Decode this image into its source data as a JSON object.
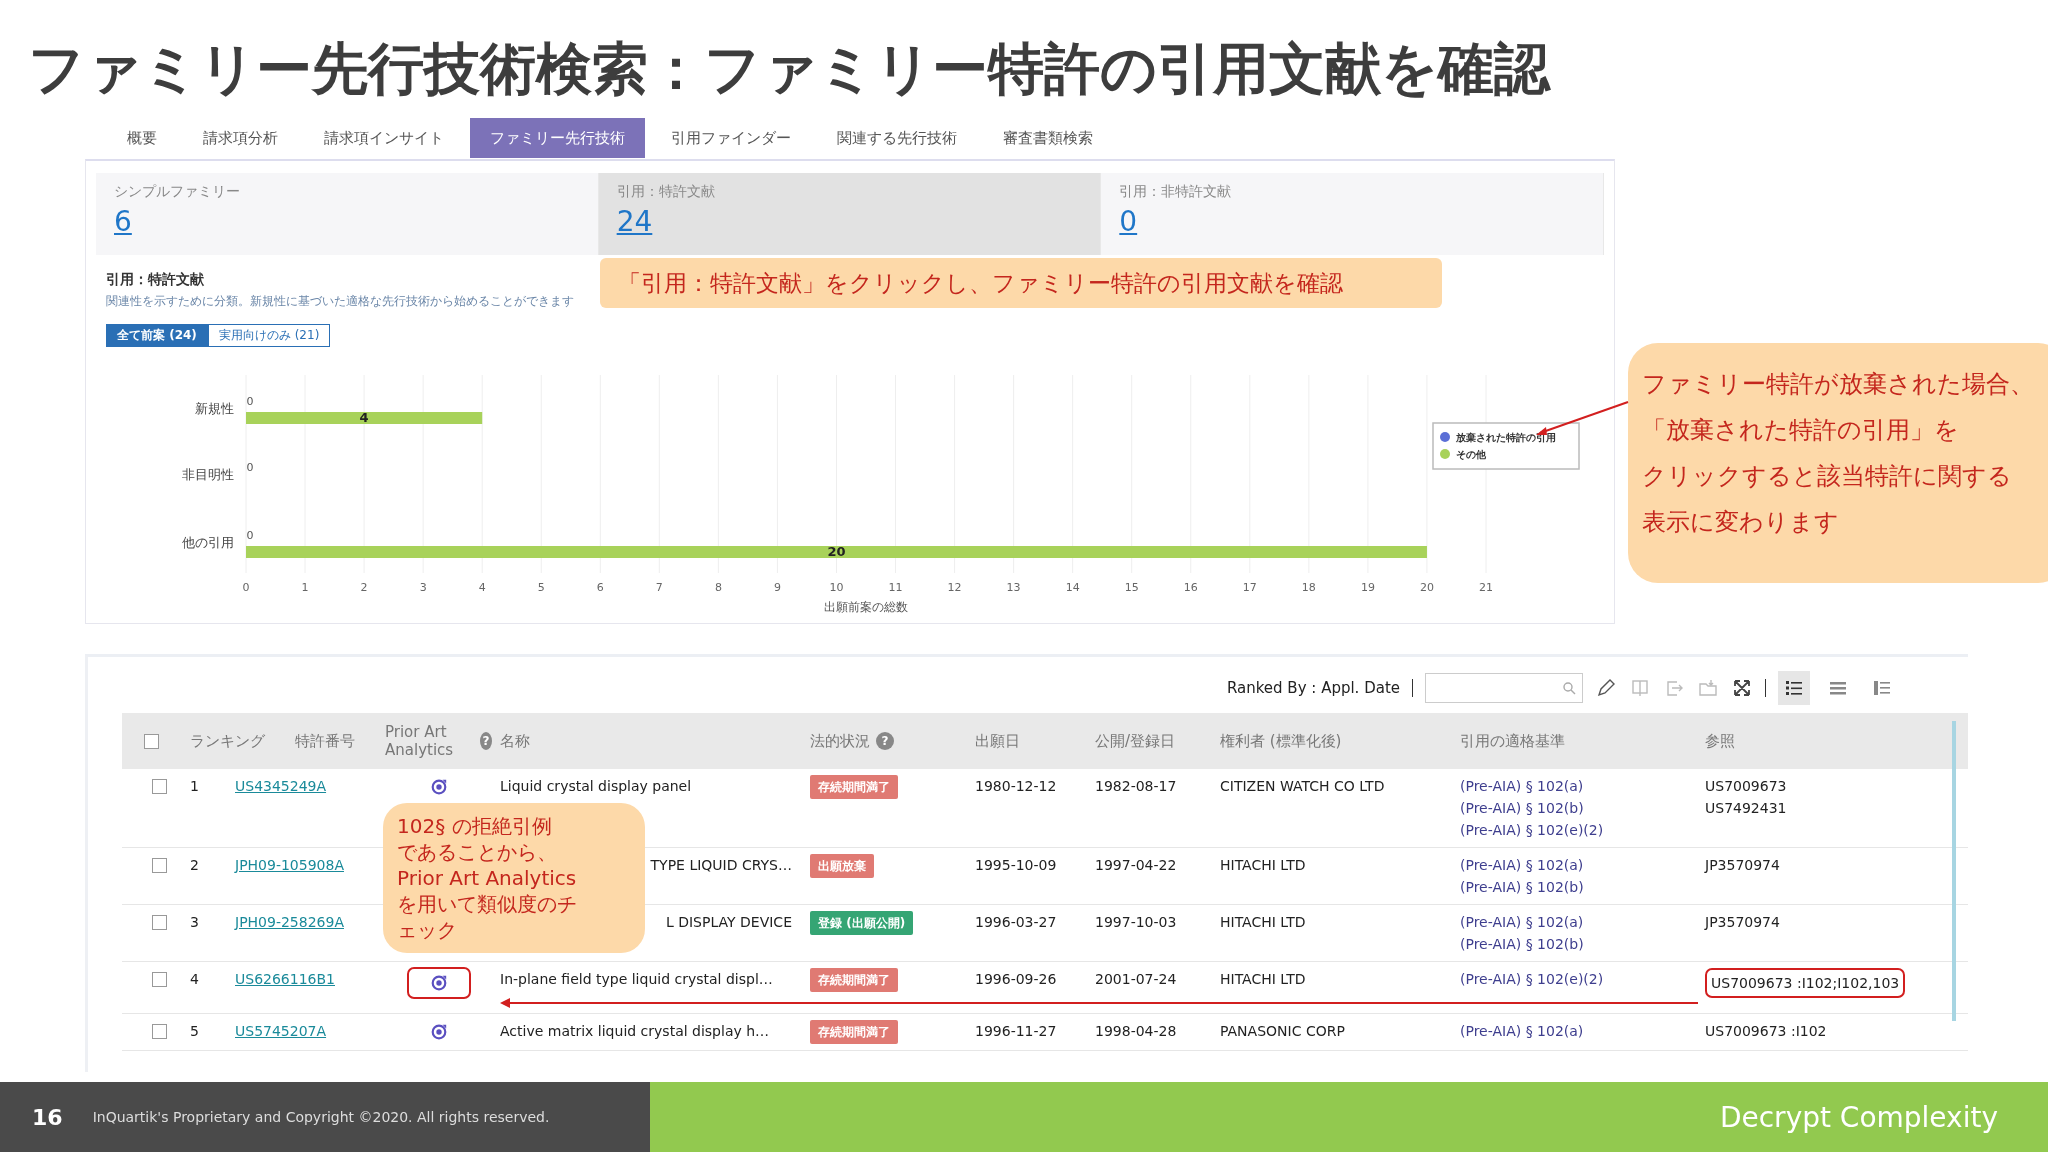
{
  "title": "ファミリー先行技術検索：ファミリー特許の引用文献を確認",
  "tabs": [
    {
      "label": "概要",
      "selected": false
    },
    {
      "label": "請求項分析",
      "selected": false
    },
    {
      "label": "請求項インサイト",
      "selected": false
    },
    {
      "label": "ファミリー先行技術",
      "selected": true
    },
    {
      "label": "引用ファインダー",
      "selected": false
    },
    {
      "label": "関連する先行技術",
      "selected": false
    },
    {
      "label": "審査書類検索",
      "selected": false
    }
  ],
  "stats": [
    {
      "label": "シンプルファミリー",
      "value": "6",
      "selected": false
    },
    {
      "label": "引用：特許文献",
      "value": "24",
      "selected": true
    },
    {
      "label": "引用：非特許文献",
      "value": "0",
      "selected": false
    }
  ],
  "chart_section": {
    "title": "引用：特許文献",
    "description": "関連性を示すために分類。新規性に基づいた適格な先行技術から始めることができます",
    "filters": [
      {
        "label": "全て前案 (24)",
        "selected": true
      },
      {
        "label": "実用向けのみ (21)",
        "selected": false
      }
    ],
    "chart_data": {
      "type": "bar",
      "orientation": "horizontal",
      "xlabel": "出願前案の総数",
      "categories": [
        "新規性",
        "非目明性",
        "他の引用"
      ],
      "series": [
        {
          "name": "放棄された特許の引用",
          "color": "#5b6fd6",
          "values": [
            0,
            0,
            0
          ],
          "value_labels": [
            "0",
            "0",
            "0"
          ]
        },
        {
          "name": "その他",
          "color": "#a8d25a",
          "values": [
            4,
            0,
            20
          ],
          "value_labels": [
            "4",
            null,
            "20"
          ]
        }
      ],
      "xlim": [
        0,
        21
      ],
      "xticks": [
        0,
        1,
        2,
        3,
        4,
        5,
        6,
        7,
        8,
        9,
        10,
        11,
        12,
        13,
        14,
        15,
        16,
        17,
        18,
        19,
        20,
        21
      ],
      "grid": true,
      "legend": "right"
    }
  },
  "table": {
    "ranked_by": "Ranked By : Appl. Date",
    "view_modes": [
      {
        "selected": true
      },
      {
        "selected": false
      },
      {
        "selected": false
      }
    ],
    "header_checkbox": {
      "checked": false
    },
    "columns": [
      {
        "label": "ランキング"
      },
      {
        "label": "特許番号"
      },
      {
        "label": "Prior Art Analytics",
        "help": "?"
      },
      {
        "label": "名称"
      },
      {
        "label": "法的状況",
        "help": "?"
      },
      {
        "label": "出願日"
      },
      {
        "label": "公開/登録日"
      },
      {
        "label": "権利者 (標準化後)"
      },
      {
        "label": "引用の適格基準"
      },
      {
        "label": "参照"
      }
    ],
    "rows": [
      {
        "checked": false,
        "highlighted": false,
        "rank": "1",
        "number": "US4345249A",
        "analytics": true,
        "name": "Liquid crystal display panel",
        "covered": false,
        "status": "存続期間満了",
        "color": "#e07a73",
        "filed": "1980-12-12",
        "published": "1982-08-17",
        "owner": "CITIZEN WATCH CO LTD",
        "criteria": [
          "(Pre-AIA) § 102(a)",
          "(Pre-AIA) § 102(b)",
          "(Pre-AIA) § 102(e)(2)"
        ],
        "references": [
          "US7009673",
          "US7492431"
        ]
      },
      {
        "checked": false,
        "highlighted": false,
        "rank": "2",
        "number": "JPH09-105908A",
        "analytics": false,
        "name": "TYPE LIQUID CRYS…",
        "covered": true,
        "status": "出願放棄",
        "color": "#e07a73",
        "filed": "1995-10-09",
        "published": "1997-04-22",
        "owner": "HITACHI LTD",
        "criteria": [
          "(Pre-AIA) § 102(a)",
          "(Pre-AIA) § 102(b)"
        ],
        "references": [
          "JP3570974"
        ]
      },
      {
        "checked": false,
        "highlighted": false,
        "rank": "3",
        "number": "JPH09-258269A",
        "analytics": false,
        "name": "L DISPLAY DEVICE",
        "covered": true,
        "status": "登録 (出願公開)",
        "color": "#35a574",
        "filed": "1996-03-27",
        "published": "1997-10-03",
        "owner": "HITACHI LTD",
        "criteria": [
          "(Pre-AIA) § 102(a)",
          "(Pre-AIA) § 102(b)"
        ],
        "references": [
          "JP3570974"
        ]
      },
      {
        "checked": false,
        "highlighted": true,
        "rank": "4",
        "number": "US6266116B1",
        "analytics": true,
        "name": "In-plane field type liquid crystal displ…",
        "covered": false,
        "status": "存続期間満了",
        "color": "#e07a73",
        "filed": "1996-09-26",
        "published": "2001-07-24",
        "owner": "HITACHI LTD",
        "criteria": [
          "(Pre-AIA) § 102(e)(2)"
        ],
        "references": [
          "US7009673 :I102;I102,103"
        ]
      },
      {
        "checked": false,
        "highlighted": false,
        "rank": "5",
        "number": "US5745207A",
        "analytics": true,
        "name": "Active matrix liquid crystal display h…",
        "covered": false,
        "status": "存続期間満了",
        "color": "#e07a73",
        "filed": "1996-11-27",
        "published": "1998-04-28",
        "owner": "PANASONIC CORP",
        "criteria": [
          "(Pre-AIA) § 102(a)"
        ],
        "references": [
          "US7009673 :I102"
        ]
      }
    ]
  },
  "callouts": [
    {
      "lines": [
        "「引用：特許文献」をクリックし、ファミリー特許の引用文献を確認"
      ]
    },
    {
      "lines": [
        "ファミリー特許が放棄された場合、",
        "「放棄された特許の引用」を",
        "クリックすると該当特許に関する",
        "表示に変わります"
      ]
    },
    {
      "lines": [
        "102§ の拒絶引例",
        "であることから、",
        "Prior Art Analytics",
        "を用いて類似度のチ",
        "ェック"
      ]
    }
  ],
  "footer": {
    "page": "16",
    "copyright": "InQuartik's Proprietary and Copyright ©2020. All rights reserved.",
    "tagline": "Decrypt Complexity"
  }
}
